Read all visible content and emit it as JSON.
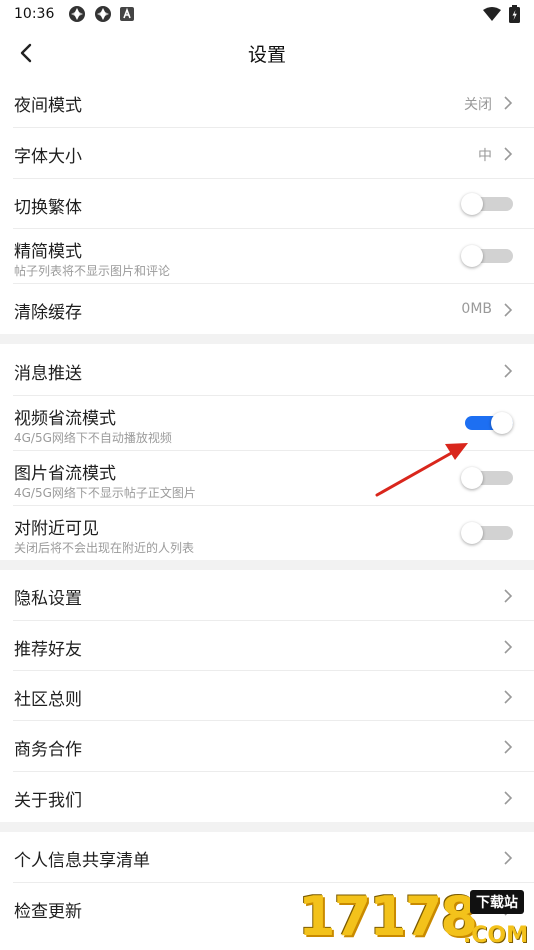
{
  "status_bar": {
    "time": "10:36"
  },
  "header": {
    "title": "设置"
  },
  "group1": {
    "night_mode": {
      "label": "夜间模式",
      "value": "关闭"
    },
    "font_size": {
      "label": "字体大小",
      "value": "中"
    },
    "traditional": {
      "label": "切换繁体",
      "on": false
    },
    "lite_mode": {
      "label": "精简模式",
      "desc": "帖子列表将不显示图片和评论",
      "on": false
    },
    "clear_cache": {
      "label": "清除缓存",
      "value": "0MB"
    }
  },
  "group2": {
    "push": {
      "label": "消息推送"
    },
    "video_saver": {
      "label": "视频省流模式",
      "desc": "4G/5G网络下不自动播放视频",
      "on": true
    },
    "image_saver": {
      "label": "图片省流模式",
      "desc": "4G/5G网络下不显示帖子正文图片",
      "on": false
    },
    "nearby": {
      "label": "对附近可见",
      "desc": "关闭后将不会出现在附近的人列表",
      "on": false
    }
  },
  "group3": {
    "privacy": {
      "label": "隐私设置"
    },
    "recommend": {
      "label": "推荐好友"
    },
    "rules": {
      "label": "社区总则"
    },
    "business": {
      "label": "商务合作"
    },
    "about": {
      "label": "关于我们"
    }
  },
  "group4": {
    "share_list": {
      "label": "个人信息共享清单"
    },
    "update": {
      "label": "检查更新"
    }
  },
  "watermark": {
    "number": "17178",
    "badge": "下载站",
    "domain": ".COM"
  },
  "colors": {
    "accent": "#1d6ff2",
    "arrow": "#d9261c",
    "divider": "#f2f2f2"
  }
}
